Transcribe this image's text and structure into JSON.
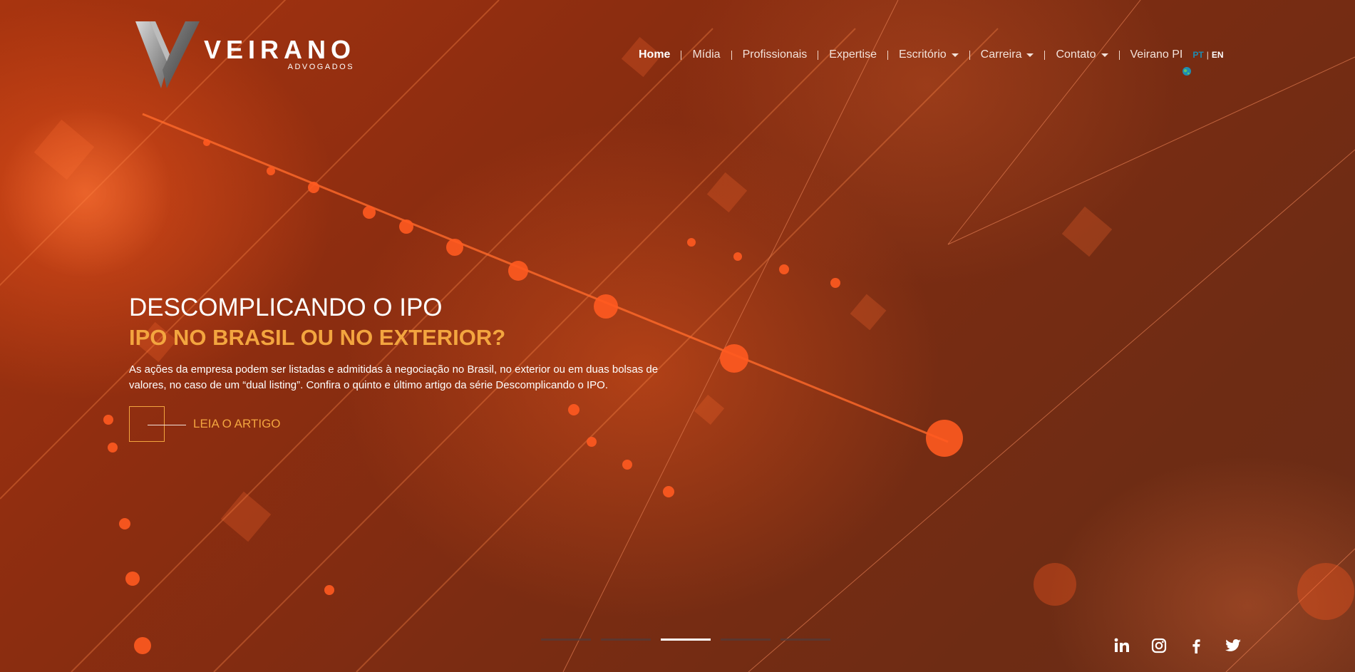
{
  "brand": {
    "name": "VEIRANO",
    "sub": "ADVOGADOS"
  },
  "nav": {
    "items": [
      {
        "label": "Home"
      },
      {
        "label": "Mídia"
      },
      {
        "label": "Profissionais"
      },
      {
        "label": "Expertise"
      },
      {
        "label": "Escritório"
      },
      {
        "label": "Carreira"
      },
      {
        "label": "Contato"
      },
      {
        "label": "Veirano PI"
      }
    ],
    "lang_pt": "PT",
    "lang_sep": "|",
    "lang_en": "EN"
  },
  "hero": {
    "title": "DESCOMPLICANDO O IPO",
    "subtitle": "IPO NO BRASIL OU NO EXTERIOR?",
    "text": "As ações da empresa podem ser listadas e admitidas à negociação no Brasil, no exterior ou em duas bolsas de valores, no caso de um “dual listing”. Confira o quinto e último artigo da série Descomplicando o IPO.",
    "cta_label": "LEIA O ARTIGO"
  },
  "slider": {
    "count": 5,
    "active_index": 2
  },
  "social": [
    "linkedin-icon",
    "instagram-icon",
    "facebook-icon",
    "twitter-icon"
  ],
  "colors": {
    "accent": "#f3a53f",
    "lang_active": "#1d8db3"
  }
}
